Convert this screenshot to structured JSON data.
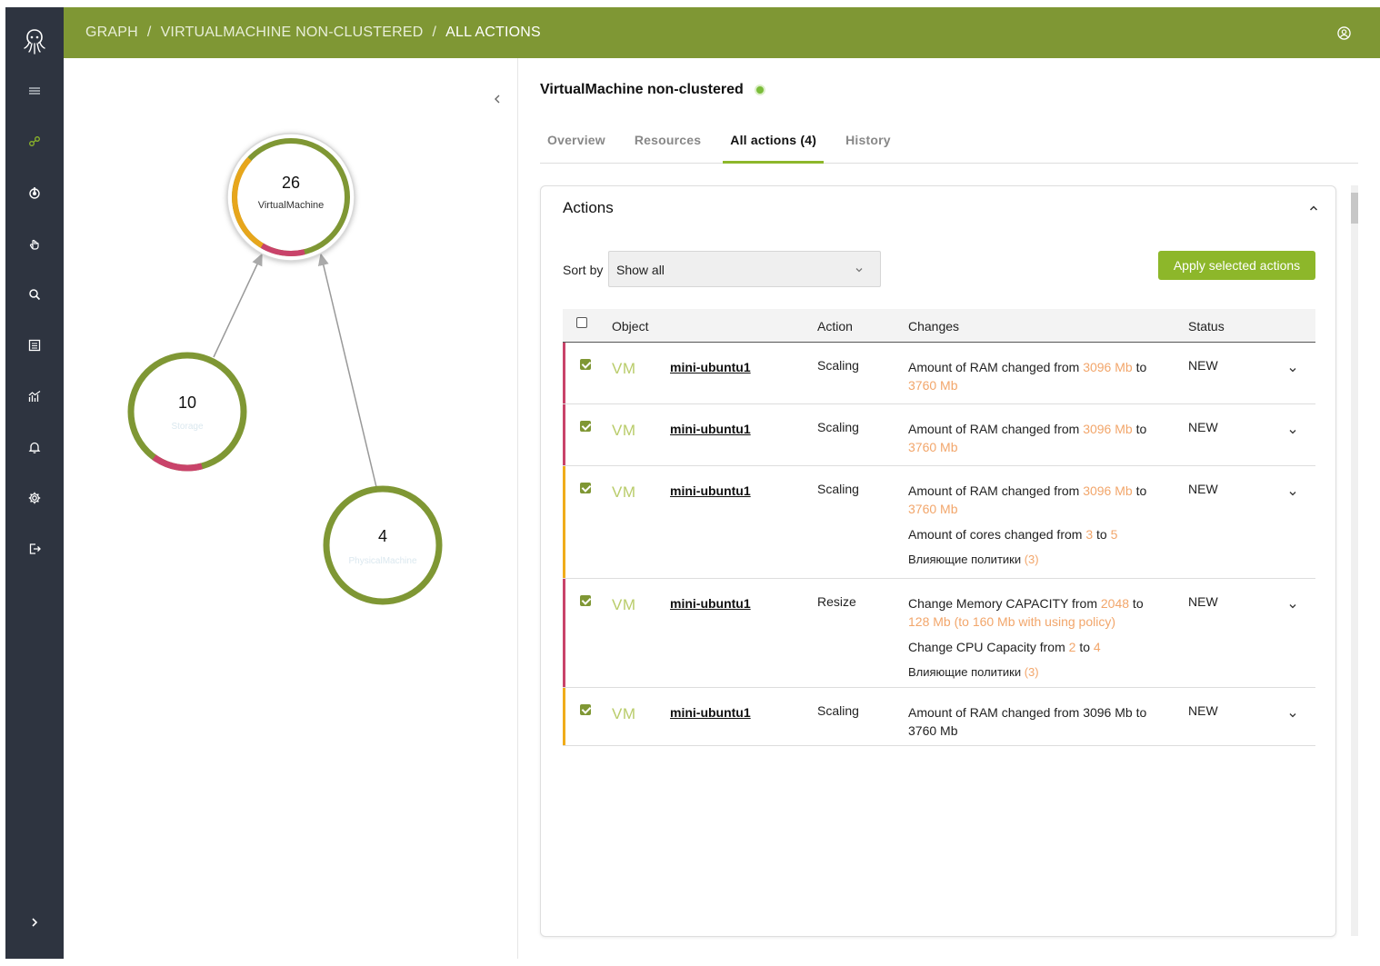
{
  "header": {
    "crumbs": [
      "GRAPH",
      "VIRTUALMACHINE NON-CLUSTERED",
      "ALL ACTIONS"
    ],
    "separator": "/"
  },
  "sidebar": {
    "items": [
      {
        "icon": "layers-icon"
      },
      {
        "icon": "graph-icon"
      },
      {
        "icon": "power-icon"
      },
      {
        "icon": "hand-icon"
      },
      {
        "icon": "search-icon"
      },
      {
        "icon": "list-icon"
      },
      {
        "icon": "analytics-icon"
      },
      {
        "icon": "bell-icon"
      },
      {
        "icon": "gear-icon"
      },
      {
        "icon": "logout-icon"
      }
    ],
    "expand_icon": "chevron-right-icon"
  },
  "graph": {
    "nodes": [
      {
        "count": "26",
        "label": "VirtualMachine"
      },
      {
        "count": "10",
        "label": "Storage"
      },
      {
        "count": "4",
        "label": "PhysicalMachine"
      }
    ]
  },
  "panel": {
    "title": "VirtualMachine non-clustered",
    "tabs": [
      "Overview",
      "Resources",
      "All actions (4)",
      "History"
    ],
    "active_tab": "All actions (4)"
  },
  "actions": {
    "title": "Actions",
    "sort_label": "Sort by",
    "sort_value": "Show all",
    "apply_label": "Apply selected actions",
    "columns": [
      "Object",
      "Action",
      "Changes",
      "Status"
    ],
    "rows": [
      {
        "type": "VM",
        "object": "mini-ubuntu1",
        "action": "Scaling",
        "status": "NEW",
        "color": "#c9436a",
        "changes": [
          {
            "parts": [
              [
                "Amount of RAM changed from ",
                false
              ],
              [
                "3096 Mb",
                true
              ],
              [
                " to ",
                false
              ],
              [
                "3760 Mb",
                true
              ]
            ]
          }
        ]
      },
      {
        "type": "VM",
        "object": "mini-ubuntu1",
        "action": "Scaling",
        "status": "NEW",
        "color": "#c9436a",
        "changes": [
          {
            "parts": [
              [
                "Amount of RAM changed from ",
                false
              ],
              [
                "3096 Mb",
                true
              ],
              [
                " to ",
                false
              ],
              [
                "3760 Mb",
                true
              ]
            ]
          }
        ]
      },
      {
        "type": "VM",
        "object": "mini-ubuntu1",
        "action": "Scaling",
        "status": "NEW",
        "color": "#f0ac1a",
        "changes": [
          {
            "parts": [
              [
                "Amount of RAM changed from ",
                false
              ],
              [
                "3096 Mb",
                true
              ],
              [
                " to ",
                false
              ],
              [
                "3760 Mb",
                true
              ]
            ]
          },
          {
            "parts": [
              [
                "Amount of cores changed  from ",
                false
              ],
              [
                "3",
                true
              ],
              [
                " to ",
                false
              ],
              [
                "5",
                true
              ]
            ]
          },
          {
            "policy": true,
            "parts": [
              [
                "Влияющие политики ",
                false
              ],
              [
                "(3)",
                true
              ]
            ]
          }
        ]
      },
      {
        "type": "VM",
        "object": "mini-ubuntu1",
        "action": "Resize",
        "status": "NEW",
        "color": "#c9436a",
        "changes": [
          {
            "parts": [
              [
                "Change Memory CAPACITY from ",
                false
              ],
              [
                "2048",
                true
              ],
              [
                " to ",
                false
              ],
              [
                "128 Mb (to 160 Mb with using policy)",
                true
              ]
            ]
          },
          {
            "parts": [
              [
                "Change CPU Capacity from ",
                false
              ],
              [
                "2",
                true
              ],
              [
                " to ",
                false
              ],
              [
                "4",
                true
              ]
            ]
          },
          {
            "policy": true,
            "parts": [
              [
                "Влияющие политики ",
                false
              ],
              [
                "(3)",
                true
              ]
            ]
          }
        ]
      },
      {
        "type": "VM",
        "object": "mini-ubuntu1",
        "action": "Scaling",
        "status": "NEW",
        "color": "#f0ac1a",
        "changes": [
          {
            "parts": [
              [
                "Amount of RAM changed from 3096 Mb to 3760 Mb",
                false
              ]
            ]
          }
        ]
      }
    ]
  },
  "colors": {
    "header": "#7f9734",
    "sidebar": "#2e3440",
    "accent": "#8db72a",
    "critical": "#c9436a",
    "warning": "#f0ac1a",
    "highlight": "#f2a66b"
  }
}
